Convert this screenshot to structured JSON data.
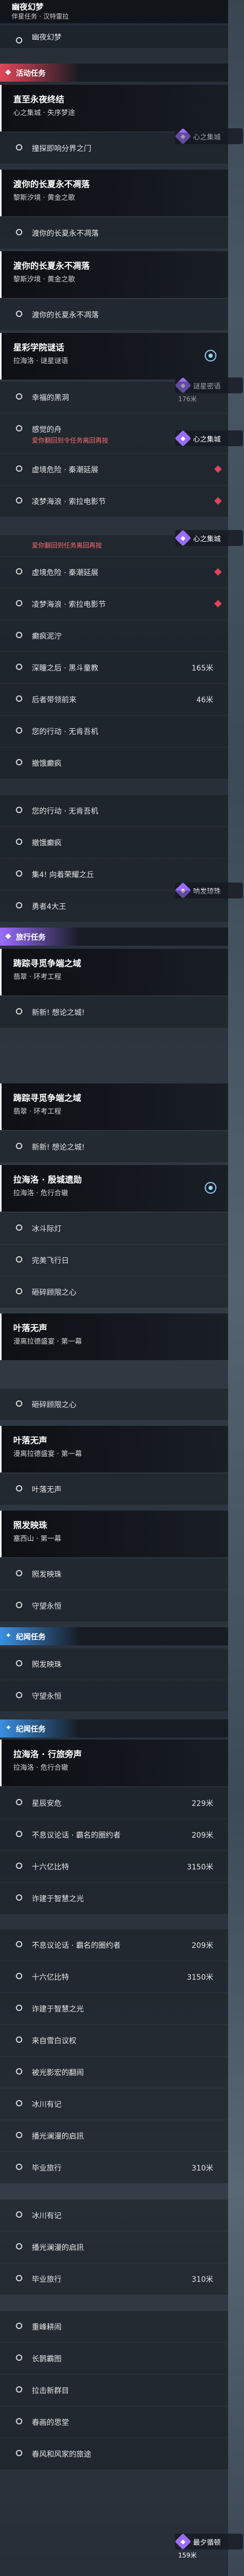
{
  "pinned_quest": {
    "title": "幽夜幻梦",
    "subtitle": "伴星任务 · 汉特雷拉"
  },
  "section_top": {
    "label": "幽夜幻梦"
  },
  "sections": {
    "event": "活动任务",
    "travel": "旅行任务",
    "discovery": "纪闻任务",
    "discovery2": "纪闻任务"
  },
  "quests": [
    {
      "title": "直至永夜终结",
      "subtitle": "心之集城 · 失序梦途"
    },
    {
      "title": "渡你的长夏永不凋落",
      "subtitle": "黎斯汐境 · 黄金之歌"
    },
    {
      "title": "渡你的长夏永不凋落",
      "subtitle": "黎斯汐境 · 黄金之歌"
    },
    {
      "title": "星彩学院谜话",
      "subtitle": "拉海洛 · 谜星谜语"
    },
    {
      "title": "踌踪寻觅争端之域",
      "subtitle": "翡翠 · 环考工程"
    },
    {
      "title": "踌踪寻觅争端之域",
      "subtitle": "翡翠 · 环考工程"
    },
    {
      "title": "拉海洛 · 殷城遗勋",
      "subtitle": "拉海洛 · 危行合辙"
    },
    {
      "title": "叶落无声",
      "subtitle": "漫离拉德盛宴 · 第一幕"
    },
    {
      "title": "叶落无声",
      "subtitle": "漫离拉德盛宴 · 第一幕"
    },
    {
      "title": "照发映珠",
      "subtitle": "塞西山 · 第一幕"
    },
    {
      "title": "拉海洛 · 行旅旁声",
      "subtitle": "拉海洛 · 危行合辙"
    }
  ],
  "objectives": [
    {
      "text": "幽夜幻梦",
      "dist": ""
    },
    {
      "text": "撞探即响分界之门",
      "dist": ""
    },
    {
      "text": "渡你的长夏永不凋落",
      "dist": ""
    },
    {
      "text": "渡你的长夏永不凋落",
      "dist": ""
    },
    {
      "text": "幸福的黑洞",
      "dist": ""
    },
    {
      "text": "感觉的舟",
      "dist": ""
    },
    {
      "text": "虚境危险 · 秦潮延展",
      "dist": "176米"
    },
    {
      "text": "凌梦海浪 · 索拉电影节",
      "dist": ""
    },
    {
      "text": "虚境危险 · 秦潮延展",
      "dist": ""
    },
    {
      "text": "凌梦海浪 · 索拉电影节",
      "dist": ""
    },
    {
      "text": "癫疯泥泞",
      "dist": ""
    },
    {
      "text": "深瞳之后 · 黑斗童教",
      "dist": "165米"
    },
    {
      "text": "后者带领前来",
      "dist": "46米"
    },
    {
      "text": "您的行动 · 无肯吾机",
      "dist": ""
    },
    {
      "text": "撤饿癫疯",
      "dist": ""
    },
    {
      "text": "您的行动 · 无肯吾机",
      "dist": ""
    },
    {
      "text": "撤饿癫疯",
      "dist": ""
    },
    {
      "text": "集4! 向着荣耀之丘",
      "dist": ""
    },
    {
      "text": "勇者4大王",
      "dist": ""
    },
    {
      "text": "新新! 想论之城!",
      "dist": ""
    },
    {
      "text": "新新! 想论之城!",
      "dist": ""
    },
    {
      "text": "冰斗际灯",
      "dist": ""
    },
    {
      "text": "完美飞行日",
      "dist": ""
    },
    {
      "text": "砸碎顾限之心",
      "dist": ""
    },
    {
      "text": "砸碎顾限之心",
      "dist": ""
    },
    {
      "text": "叶落无声",
      "dist": ""
    },
    {
      "text": "照发映珠",
      "dist": ""
    },
    {
      "text": "守望永恒",
      "dist": ""
    },
    {
      "text": "照发映珠",
      "dist": ""
    },
    {
      "text": "守望永恒",
      "dist": ""
    },
    {
      "text": "星辰安危",
      "dist": "229米"
    },
    {
      "text": "不息议论话 · 霸名的圈约者",
      "dist": "209米"
    },
    {
      "text": "十六亿比特",
      "dist": "3150米"
    },
    {
      "text": "诈建于智慧之光",
      "dist": ""
    },
    {
      "text": "不息议论话 · 霸名的圈约者",
      "dist": "209米"
    },
    {
      "text": "十六亿比特",
      "dist": "3150米"
    },
    {
      "text": "诈建于智慧之光",
      "dist": ""
    },
    {
      "text": "来自雪白议权",
      "dist": ""
    },
    {
      "text": "被光影宏的翻闹",
      "dist": ""
    },
    {
      "text": "冰川有记",
      "dist": ""
    },
    {
      "text": "播光澜漫的启訊",
      "dist": ""
    },
    {
      "text": "毕业旅行",
      "dist": "310米"
    },
    {
      "text": "冰川有记",
      "dist": ""
    },
    {
      "text": "播光澜漫的启訊",
      "dist": ""
    },
    {
      "text": "毕业旅行",
      "dist": "310米"
    },
    {
      "text": "重峰耕闹",
      "dist": ""
    },
    {
      "text": "长鹊霸图",
      "dist": ""
    },
    {
      "text": "拉击新群目",
      "dist": ""
    },
    {
      "text": "春画的思堂",
      "dist": ""
    },
    {
      "text": "春风和风家的旅途",
      "dist": ""
    }
  ],
  "badges": [
    {
      "label": "心之集城",
      "dist": ""
    },
    {
      "label": "心之集城",
      "dist": ""
    },
    {
      "label": "谜星密语",
      "dist": "176米"
    },
    {
      "label": "心之集城",
      "dist": ""
    },
    {
      "label": "呐发琼珠",
      "dist": ""
    },
    {
      "label": "最夕循顿",
      "dist": "159米"
    }
  ],
  "red_note_1": "爱你翻回到令任务离回再按",
  "red_note_2": "爱你翻回到任务离回再按",
  "colors": {
    "event_section": "#e0465a",
    "travel_section": "#9b6cff",
    "discovery_section": "#3a8fe0",
    "target_ring": "#8fd2ff",
    "marker_red": "#e0465a"
  }
}
